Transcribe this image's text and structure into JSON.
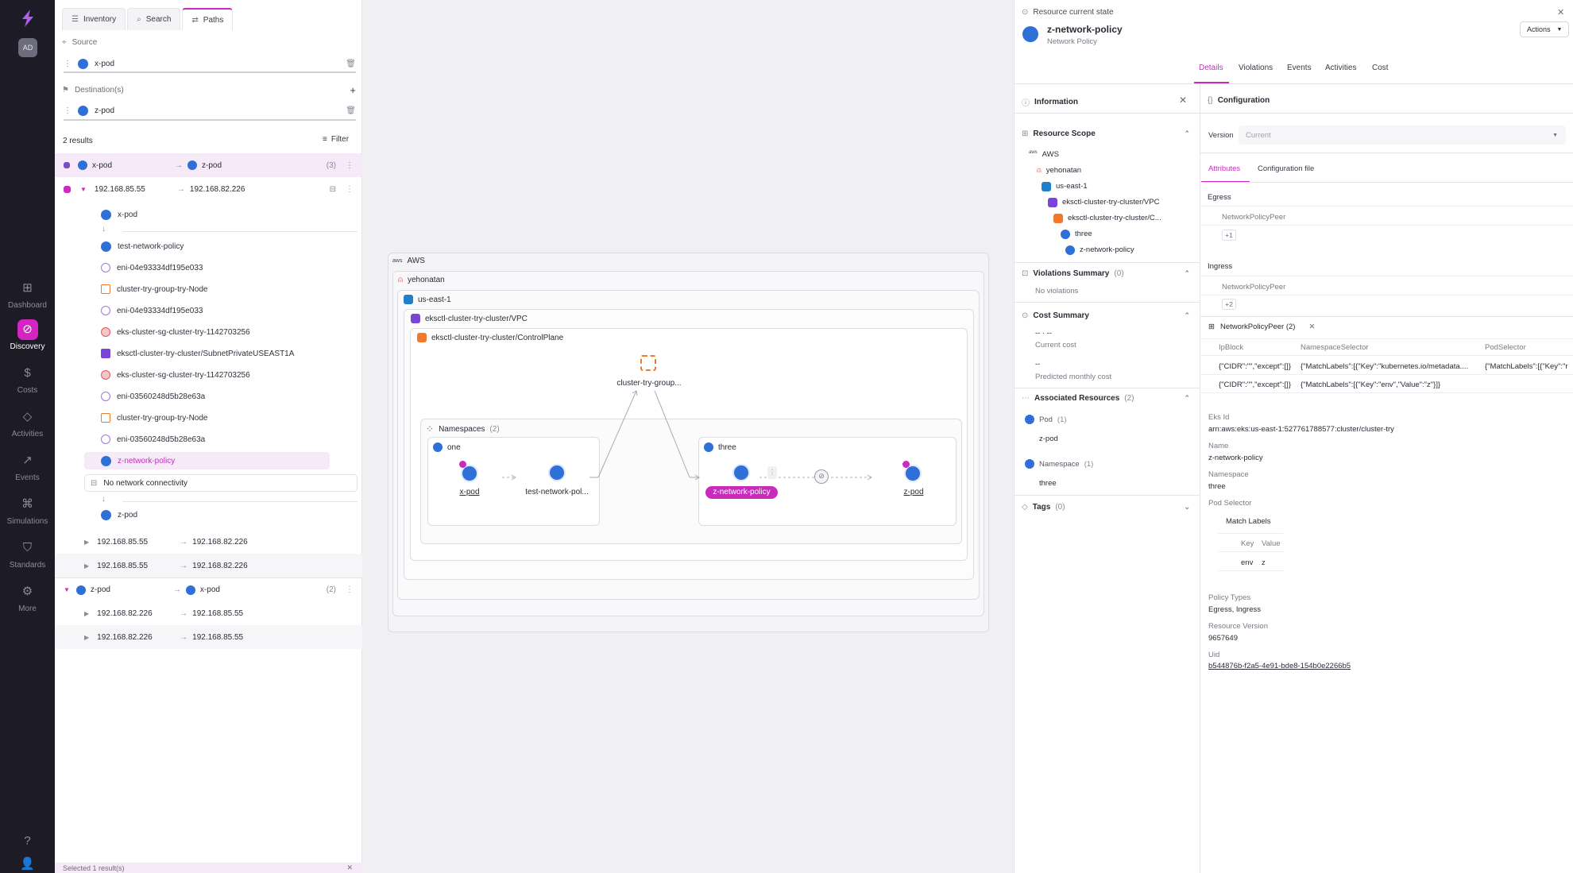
{
  "nav": {
    "avatar": "AD",
    "items": [
      {
        "label": "Dashboard",
        "icon": "grid-icon"
      },
      {
        "label": "Discovery",
        "icon": "compass-icon"
      },
      {
        "label": "Costs",
        "icon": "dollar-icon"
      },
      {
        "label": "Activities",
        "icon": "activity-icon"
      },
      {
        "label": "Events",
        "icon": "chart-icon"
      },
      {
        "label": "Simulations",
        "icon": "network-icon"
      },
      {
        "label": "Standards",
        "icon": "shield-icon"
      },
      {
        "label": "More",
        "icon": "gear-icon"
      }
    ]
  },
  "left": {
    "tabs": [
      {
        "label": "Inventory"
      },
      {
        "label": "Search"
      },
      {
        "label": "Paths"
      }
    ],
    "source_label": "Source",
    "source_value": "x-pod",
    "dest_label": "Destination(s)",
    "dest_value": "z-pod",
    "results": "2 results",
    "filter": "Filter",
    "group1": {
      "from": "x-pod",
      "to": "z-pod",
      "count": "(3)"
    },
    "path1": {
      "from": "192.168.85.55",
      "to": "192.168.82.226"
    },
    "path_items": [
      "x-pod",
      "test-network-policy",
      "eni-04e93334df195e033",
      "cluster-try-group-try-Node",
      "eni-04e93334df195e033",
      "eks-cluster-sg-cluster-try-1142703256",
      "eksctl-cluster-try-cluster/SubnetPrivateUSEAST1A",
      "eks-cluster-sg-cluster-try-1142703256",
      "eni-03560248d5b28e63a",
      "cluster-try-group-try-Node",
      "eni-03560248d5b28e63a",
      "z-network-policy"
    ],
    "no_connectivity": "No network connectivity",
    "end_item": "z-pod",
    "path2": {
      "from": "192.168.85.55",
      "to": "192.168.82.226"
    },
    "path3": {
      "from": "192.168.85.55",
      "to": "192.168.82.226"
    },
    "group2": {
      "from": "z-pod",
      "to": "x-pod",
      "count": "(2)"
    },
    "path4": {
      "from": "192.168.82.226",
      "to": "192.168.85.55"
    },
    "path5": {
      "from": "192.168.82.226",
      "to": "192.168.85.55"
    },
    "footer": "Selected 1 result(s)"
  },
  "canvas": {
    "aws": "AWS",
    "account": "yehonatan",
    "region": "us-east-1",
    "vpc": "eksctl-cluster-try-cluster/VPC",
    "control_plane": "eksctl-cluster-try-cluster/ControlPlane",
    "node_group": "cluster-try-group...",
    "namespaces": "Namespaces",
    "namespaces_count": "(2)",
    "ns_one": "one",
    "ns_three": "three",
    "x_pod": "x-pod",
    "test_np": "test-network-pol...",
    "z_np": "z-network-policy",
    "z_pod": "z-pod"
  },
  "right": {
    "header_caption": "Resource current state",
    "title": "z-network-policy",
    "subtitle": "Network Policy",
    "actions": "Actions",
    "tabs": [
      {
        "label": "Details"
      },
      {
        "label": "Violations"
      },
      {
        "label": "Events"
      },
      {
        "label": "Activities"
      },
      {
        "label": "Cost"
      }
    ],
    "information": "Information",
    "resource_scope": "Resource Scope",
    "scope": [
      "AWS",
      "yehonatan",
      "us-east-1",
      "eksctl-cluster-try-cluster/VPC",
      "eksctl-cluster-try-cluster/C...",
      "three",
      "z-network-policy"
    ],
    "violations_summary": "Violations Summary",
    "violations_count": "(0)",
    "no_violations": "No violations",
    "cost_summary": "Cost Summary",
    "current_cost_value": "-- · --",
    "current_cost": "Current cost",
    "predicted_value": "--",
    "predicted": "Predicted monthly cost",
    "associated": "Associated Resources",
    "associated_count": "(2)",
    "pod_label": "Pod",
    "pod_count": "(1)",
    "pod_value": "z-pod",
    "ns_label": "Namespace",
    "ns_count": "(1)",
    "ns_value": "three",
    "tags": "Tags",
    "tags_count": "(0)",
    "configuration": "Configuration",
    "version_label": "Version",
    "version_value": "Current",
    "cfg_tabs": [
      {
        "label": "Attributes"
      },
      {
        "label": "Configuration file"
      }
    ],
    "egress": "Egress",
    "egress_peer": "NetworkPolicyPeer",
    "egress_more": "+1",
    "ingress": "Ingress",
    "ingress_peer": "NetworkPolicyPeer",
    "ingress_more": "+2",
    "peer_table_title": "NetworkPolicyPeer (2)",
    "peer_cols": [
      "IpBlock",
      "NamespaceSelector",
      "PodSelector"
    ],
    "peer_rows": [
      [
        "{\"CIDR\":\"\",\"except\":[]}",
        "{\"MatchLabels\":[{\"Key\":\"kubernetes.io/metadata....",
        "{\"MatchLabels\":[{\"Key\":\"r"
      ],
      [
        "{\"CIDR\":\"\",\"except\":[]}",
        "{\"MatchLabels\":[{\"Key\":\"env\",\"Value\":\"z\"}]}",
        ""
      ]
    ],
    "eks_id_label": "Eks Id",
    "eks_id": "arn:aws:eks:us-east-1:527761788577:cluster/cluster-try",
    "name_label": "Name",
    "name": "z-network-policy",
    "namespace_label": "Namespace",
    "namespace": "three",
    "pod_selector_label": "Pod Selector",
    "match_labels": "Match Labels",
    "key_col": "Key",
    "value_col": "Value",
    "key": "env",
    "value": "z",
    "policy_types_label": "Policy Types",
    "policy_types": "Egress, Ingress",
    "resource_version_label": "Resource Version",
    "resource_version": "9657649",
    "uid_label": "Uid",
    "uid": "b544876b-f2a5-4e91-bde8-154b0e2266b5"
  }
}
